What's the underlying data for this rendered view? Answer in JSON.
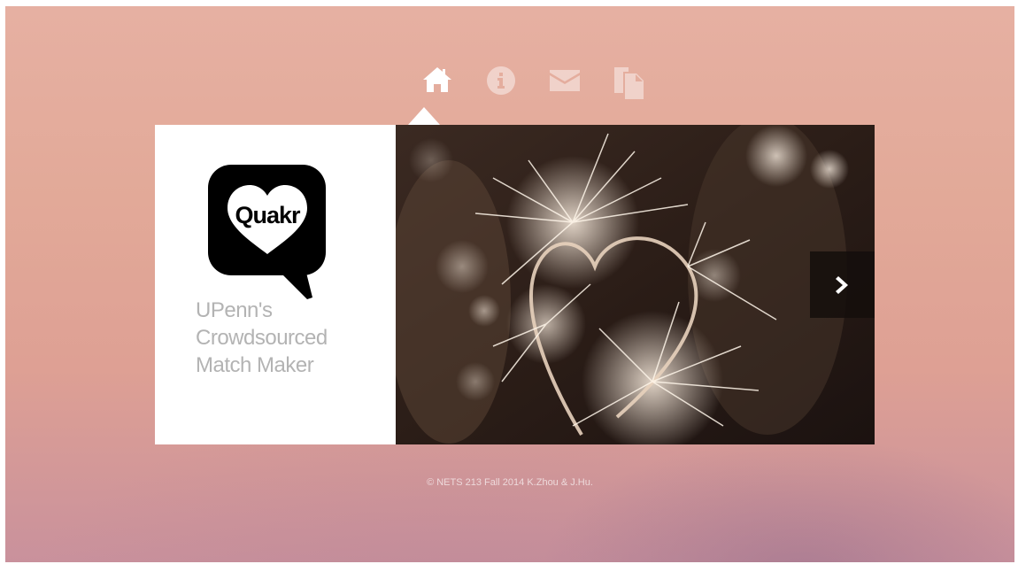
{
  "nav": {
    "items": [
      {
        "icon": "home-icon",
        "active": true
      },
      {
        "icon": "info-icon",
        "active": false
      },
      {
        "icon": "mail-icon",
        "active": false
      },
      {
        "icon": "documents-icon",
        "active": false
      }
    ]
  },
  "hero": {
    "logo_text": "Quakr",
    "tagline": [
      "UPenn's",
      "Crowdsourced",
      "Match Maker"
    ],
    "image_subject": "sparkler-heart-photo",
    "next_icon": "chevron-right-icon"
  },
  "footer": {
    "text": "© NETS 213 Fall 2014 K.Zhou & J.Hu."
  },
  "colors": {
    "background": "#e2a998",
    "card_left": "#ffffff",
    "tagline": "#b3b3b3",
    "logo": "#000000"
  }
}
